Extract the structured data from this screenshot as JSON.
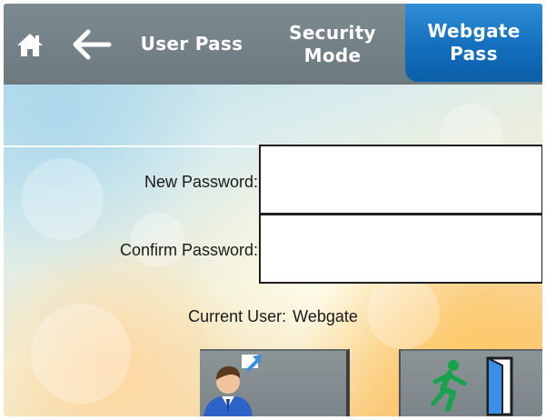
{
  "header": {
    "home_icon": "home-icon",
    "back_icon": "back-arrow-icon",
    "tabs": [
      {
        "label": "User Pass",
        "active": false
      },
      {
        "label": "Security\nMode",
        "active": false
      },
      {
        "label": "Webgate\nPass",
        "active": true
      }
    ],
    "active_color": "#1a75c4",
    "bar_color": "#75848a"
  },
  "form": {
    "new_password_label": "New Password:",
    "new_password_value": "",
    "confirm_password_label": "Confirm Password:",
    "confirm_password_value": ""
  },
  "status": {
    "current_user_label": "Current User:",
    "current_user_value": "Webgate"
  },
  "actions": {
    "user_button_icon": "user-switch-icon",
    "exit_button_icon": "exit-door-icon"
  }
}
